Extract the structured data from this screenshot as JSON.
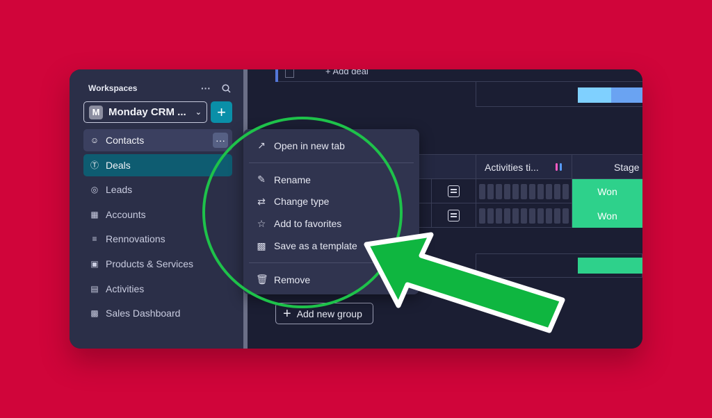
{
  "sidebar": {
    "workspaces_label": "Workspaces",
    "more_glyph": "···",
    "workspace": {
      "badge": "M",
      "name": "Monday CRM ...",
      "add_glyph": "+"
    },
    "items": [
      {
        "label": "Contacts",
        "icon": "contacts-icon"
      },
      {
        "label": "Deals",
        "icon": "dollar-icon"
      },
      {
        "label": "Leads",
        "icon": "target-icon"
      },
      {
        "label": "Accounts",
        "icon": "building-icon"
      },
      {
        "label": "Rennovations",
        "icon": "list-icon"
      },
      {
        "label": "Products & Services",
        "icon": "briefcase-icon"
      },
      {
        "label": "Activities",
        "icon": "doc-list-icon"
      },
      {
        "label": "Sales Dashboard",
        "icon": "chart-icon"
      }
    ],
    "active_item": "Deals",
    "hover_item": "Contacts"
  },
  "board": {
    "add_deal": "+ Add deal",
    "columns": {
      "activities": "Activities ti...",
      "stage": "Stage"
    },
    "rows": [
      {
        "stage": "Won"
      },
      {
        "stage": "Won"
      }
    ],
    "add_group": "Add new group"
  },
  "context_menu": {
    "items_top": [
      {
        "label": "Open in new tab",
        "icon": "external-link-icon"
      }
    ],
    "items_mid": [
      {
        "label": "Rename",
        "icon": "pencil-icon"
      },
      {
        "label": "Change type",
        "icon": "swap-icon"
      },
      {
        "label": "Add to favorites",
        "icon": "star-icon"
      },
      {
        "label": "Save as a template",
        "icon": "template-icon"
      }
    ],
    "items_bottom": [
      {
        "label": "Remove",
        "icon": "trash-icon"
      }
    ]
  },
  "colors": {
    "background": "#d0053a",
    "highlight_circle": "#1ec24a",
    "arrow": "#0fb640",
    "won": "#2ed18b",
    "active_nav": "#0e5c71"
  }
}
